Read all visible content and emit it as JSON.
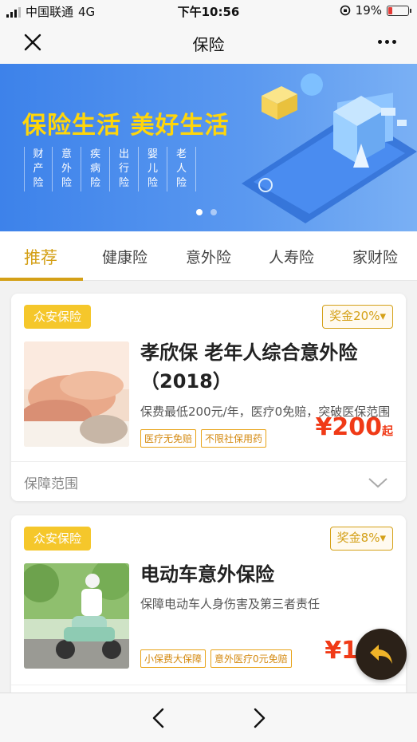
{
  "status": {
    "carrier": "中国联通",
    "network": "4G",
    "time": "下午10:56",
    "battery": "19%",
    "battery_level": 0.19
  },
  "nav": {
    "title": "保险",
    "close_icon": "close-icon",
    "more_icon": "more-icon"
  },
  "banner": {
    "headline": "保险生活 美好生活",
    "categories": [
      "财产险",
      "意外险",
      "疾病险",
      "出行险",
      "婴儿险",
      "老人险"
    ],
    "active_slide": 1,
    "slide_count": 2
  },
  "tabs": [
    {
      "label": "推荐",
      "active": true
    },
    {
      "label": "健康险",
      "active": false
    },
    {
      "label": "意外险",
      "active": false
    },
    {
      "label": "人寿险",
      "active": false
    },
    {
      "label": "家财险",
      "active": false
    }
  ],
  "products": [
    {
      "vendor": "众安保险",
      "bonus": "奖金20%▾",
      "title": "孝欣保 老年人综合意外险（2018）",
      "desc": "保费最低200元/年，医疗0免赔，突破医保范围",
      "tags": [
        "医疗无免赔",
        "不限社保用药"
      ],
      "price_currency": "¥",
      "price_value": "200",
      "price_suffix": "起",
      "scope_label": "保障范围"
    },
    {
      "vendor": "众安保险",
      "bonus": "奖金8%▾",
      "title": "电动车意外保险",
      "desc": "保障电动车人身伤害及第三者责任",
      "tags": [
        "小保费大保障",
        "意外医疗0元免赔"
      ],
      "price_currency": "¥",
      "price_value": "1"
    }
  ],
  "colors": {
    "accent": "#d4a017",
    "vendor_badge": "#f5c72b",
    "price": "#f03a17",
    "banner_blue": "#3d82ea",
    "headline_yellow": "#ffd60a"
  },
  "toolbar": {
    "back_icon": "chevron-left-icon",
    "forward_icon": "chevron-right-icon"
  },
  "fab_icon": "reply-icon"
}
